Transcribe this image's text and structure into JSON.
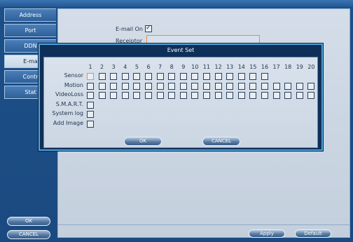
{
  "sidebar": {
    "tabs": [
      "Address",
      "Port",
      "DDN",
      "E-ma",
      "Contr",
      "Stat"
    ],
    "active_index": 3,
    "ok_label": "OK",
    "cancel_label": "CANCEL"
  },
  "main": {
    "email_on_label": "E-mail On",
    "email_on_checked": true,
    "receipt_label": "Receiptor",
    "apply_label": "Apply",
    "default_label": "Default"
  },
  "dialog": {
    "title": "Event Set",
    "columns": [
      "1",
      "2",
      "3",
      "4",
      "5",
      "6",
      "7",
      "8",
      "9",
      "10",
      "11",
      "12",
      "13",
      "14",
      "15",
      "16",
      "17",
      "18",
      "19",
      "20"
    ],
    "rows": [
      {
        "label": "Sensor",
        "count": 16
      },
      {
        "label": "Motion",
        "count": 20
      },
      {
        "label": "VideoLoss",
        "count": 20
      },
      {
        "label": "S.M.A.R.T.",
        "count": 1
      },
      {
        "label": "System log",
        "count": 1
      },
      {
        "label": "Add Image",
        "count": 1
      }
    ],
    "ok_label": "OK",
    "cancel_label": "CANCEL"
  }
}
